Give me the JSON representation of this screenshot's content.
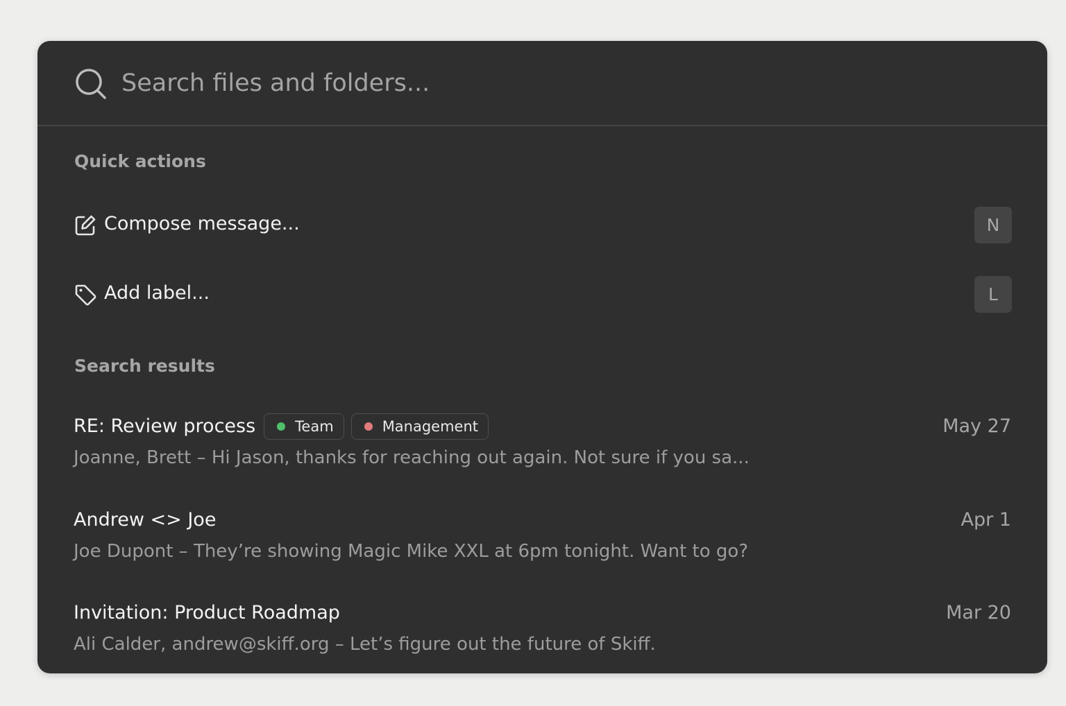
{
  "search": {
    "placeholder": "Search files and folders..."
  },
  "quick_actions": {
    "title": "Quick actions",
    "items": [
      {
        "icon": "compose-icon",
        "label": "Compose message...",
        "shortcut": "N"
      },
      {
        "icon": "tag-icon",
        "label": "Add label...",
        "shortcut": "L"
      }
    ]
  },
  "search_results": {
    "title": "Search results",
    "items": [
      {
        "title": "RE: Review process",
        "tags": [
          {
            "label": "Team",
            "color": "#4fbf6a"
          },
          {
            "label": "Management",
            "color": "#e07b7b"
          }
        ],
        "date": "May 27",
        "preview": "Joanne, Brett – Hi Jason, thanks for reaching out again. Not sure if you sa..."
      },
      {
        "title": "Andrew <> Joe",
        "tags": [],
        "date": "Apr 1",
        "preview": "Joe Dupont – They’re showing Magic Mike XXL at 6pm tonight. Want to go?"
      },
      {
        "title": "Invitation: Product Roadmap",
        "tags": [],
        "date": "Mar 20",
        "preview": "Ali Calder, andrew@skiff.org – Let’s figure out the future of Skiff."
      }
    ]
  },
  "colors": {
    "background": "#eeeeed",
    "panel": "#2f2f2f",
    "text_primary": "#f2f2f2",
    "text_secondary": "#a6a6a6"
  }
}
